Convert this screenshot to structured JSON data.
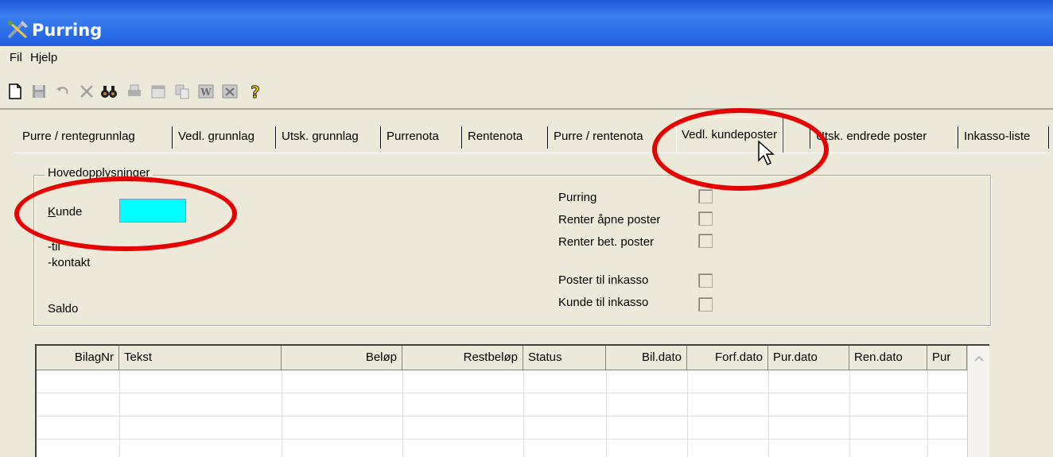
{
  "window": {
    "title": "Purring",
    "title_icon": "tools-icon"
  },
  "menu": {
    "items": [
      "Fil",
      "Hjelp"
    ]
  },
  "toolbar": {
    "icons": [
      "new-document-icon",
      "save-icon",
      "undo-icon",
      "delete-icon",
      "find-icon",
      "print-icon",
      "calendar-icon",
      "copy-icon",
      "word-icon",
      "excel-icon",
      "help-icon"
    ]
  },
  "tabs": [
    {
      "label": "Purre / rentegrunnlag"
    },
    {
      "label": "Vedl. grunnlag"
    },
    {
      "label": "Utsk. grunnlag"
    },
    {
      "label": "Purrenota"
    },
    {
      "label": "Rentenota"
    },
    {
      "label": "Purre / rentenota"
    },
    {
      "label": "Vedl. kundeposter"
    },
    {
      "label": "Utsk. endrede poster"
    },
    {
      "label": "Inkasso-liste"
    }
  ],
  "active_tab": "Vedl. kundeposter",
  "group": {
    "legend": "Hovedopplysninger",
    "kunde_label": "Kunde",
    "kunde_value": "",
    "til_label": "-til",
    "kontakt_label": "-kontakt",
    "saldo_label": "Saldo",
    "checkboxes": [
      {
        "label": "Purring",
        "checked": false
      },
      {
        "label": "Renter åpne poster",
        "checked": false
      },
      {
        "label": "Renter bet. poster",
        "checked": false
      },
      {
        "label": "Poster til inkasso",
        "checked": false
      },
      {
        "label": "Kunde til inkasso",
        "checked": false
      }
    ]
  },
  "table": {
    "columns": [
      "BilagNr",
      "Tekst",
      "Beløp",
      "Restbeløp",
      "Status",
      "Bil.dato",
      "Forf.dato",
      "Pur.dato",
      "Ren.dato",
      "Pur"
    ],
    "rows": []
  },
  "colors": {
    "title_bar": "#1d60e0",
    "kunde_field": "#00ffff",
    "annotation": "#e60000",
    "background": "#ece9d8"
  }
}
